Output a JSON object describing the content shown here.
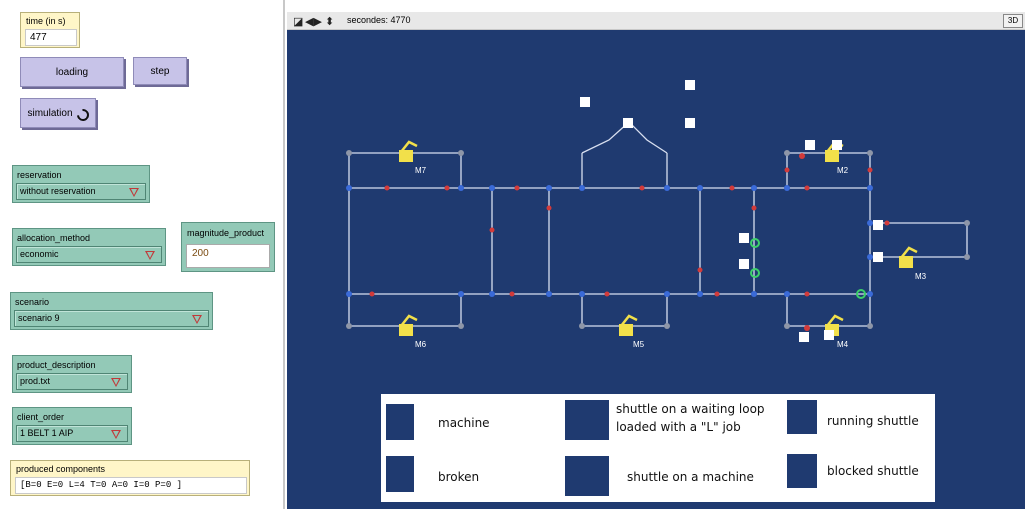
{
  "time_monitor": {
    "label": "time (in s)",
    "value": "477"
  },
  "buttons": {
    "loading": "loading",
    "step": "step",
    "simulation": "simulation"
  },
  "reservation": {
    "label": "reservation",
    "value": "without reservation"
  },
  "allocation_method": {
    "label": "allocation_method",
    "value": "economic"
  },
  "magnitude_product": {
    "label": "magnitude_product",
    "value": "200"
  },
  "scenario": {
    "label": "scenario",
    "value": "scenario 9"
  },
  "product_description": {
    "label": "product_description",
    "value": "prod.txt"
  },
  "client_order": {
    "label": "client_order",
    "value": "1 BELT 1 AIP"
  },
  "produced_components": {
    "label": "produced components",
    "value": "[B=0  E=0  L=4  T=0  A=0  I=0  P=0 ]"
  },
  "view": {
    "ticks_label": "secondes: 4770",
    "btn_3d": "3D",
    "machines": [
      "M7",
      "M2",
      "M3",
      "M6",
      "M5",
      "M4"
    ]
  },
  "legend": {
    "machine": "machine",
    "broken": "broken",
    "waiting_loop_1": "shuttle on a waiting loop",
    "waiting_loop_2": "loaded with a \"L\" job",
    "on_machine": "shuttle on a machine",
    "running": "running shuttle",
    "blocked": "blocked shuttle"
  },
  "colors": {
    "world_bg": "#1f3a70",
    "track": "#d8dff0",
    "node": "#3a6ad8",
    "arrow": "#d23a3a"
  }
}
